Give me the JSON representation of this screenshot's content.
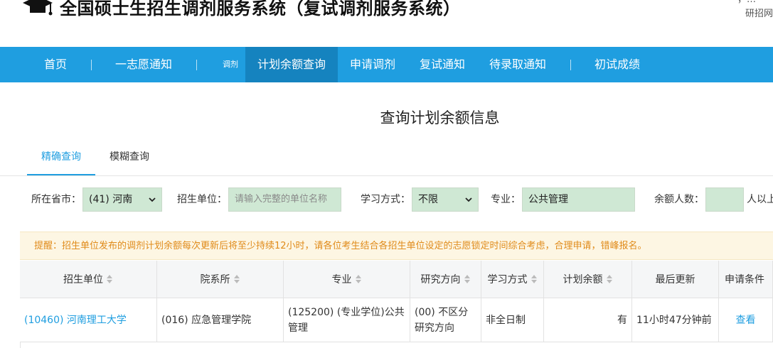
{
  "header": {
    "title": "全国硕士生招生调剂服务系统（复试调剂服务系统）",
    "top_right_fragment": "，…",
    "top_right_sub": "研招网"
  },
  "nav": {
    "items": [
      {
        "label": "首页"
      },
      {
        "label": "一志愿通知"
      },
      {
        "label": "调剂"
      },
      {
        "label": "计划余额查询"
      },
      {
        "label": "申请调剂"
      },
      {
        "label": "复试通知"
      },
      {
        "label": "待录取通知"
      },
      {
        "label": "初试成绩"
      }
    ]
  },
  "page_title": "查询计划余额信息",
  "tabs": [
    {
      "label": "精确查询"
    },
    {
      "label": "模糊查询"
    }
  ],
  "filters": {
    "province": {
      "label": "所在省市：",
      "value": "(41) 河南"
    },
    "unit": {
      "label": "招生单位：",
      "placeholder": "请输入完整的单位名称"
    },
    "study_mode": {
      "label": "学习方式：",
      "value": "不限"
    },
    "major": {
      "label": "专业：",
      "value": "公共管理"
    },
    "quota": {
      "label": "余额人数：",
      "value": "",
      "suffix": "人以上"
    }
  },
  "notice": "提醒：招生单位发布的调剂计划余额每次更新后将至少持续12小时，请各位考生结合各招生单位设定的志愿锁定时间综合考虑，合理申请，错峰报名。",
  "table": {
    "columns": [
      "招生单位",
      "院系所",
      "专业",
      "研究方向",
      "学习方式",
      "计划余额",
      "最后更新",
      "申请条件"
    ],
    "rows": [
      {
        "unit": "(10460) 河南理工大学",
        "dept": "(016) 应急管理学院",
        "major": "(125200) (专业学位)公共管理",
        "direction": "(00) 不区分研究方向",
        "mode": "非全日制",
        "balance": "有",
        "updated": "11小时47分钟前",
        "action": "查看"
      }
    ]
  },
  "colors": {
    "nav_bg": "#1f9ee0",
    "nav_active": "#1583bf",
    "link": "#1f9ee0",
    "notice_text": "#e08b1a",
    "notice_bg": "#fdf6e3",
    "input_bg": "#cfe8d4"
  }
}
